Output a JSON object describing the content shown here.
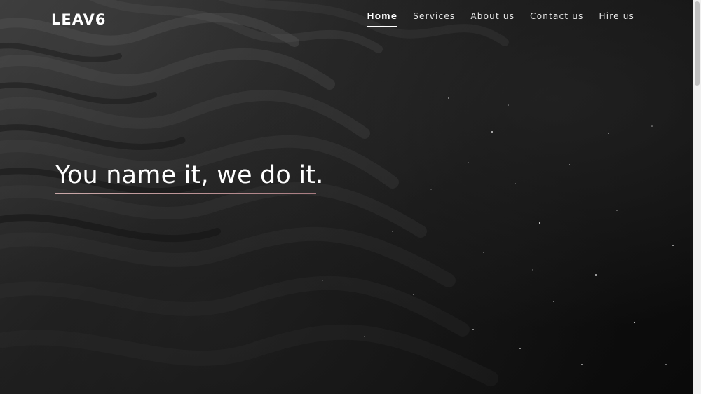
{
  "brand": {
    "name": "LEAV6"
  },
  "nav": {
    "items": [
      {
        "label": "Home",
        "active": true
      },
      {
        "label": "Services",
        "active": false
      },
      {
        "label": "About us",
        "active": false
      },
      {
        "label": "Contact us",
        "active": false
      },
      {
        "label": "Hire us",
        "active": false
      }
    ]
  },
  "hero": {
    "headline": "You name it, we do it.",
    "background": "dark-sand-texture"
  },
  "colors": {
    "background": "#0b0b0b",
    "text": "#ffffff",
    "headline_rule": "#b98f92"
  }
}
